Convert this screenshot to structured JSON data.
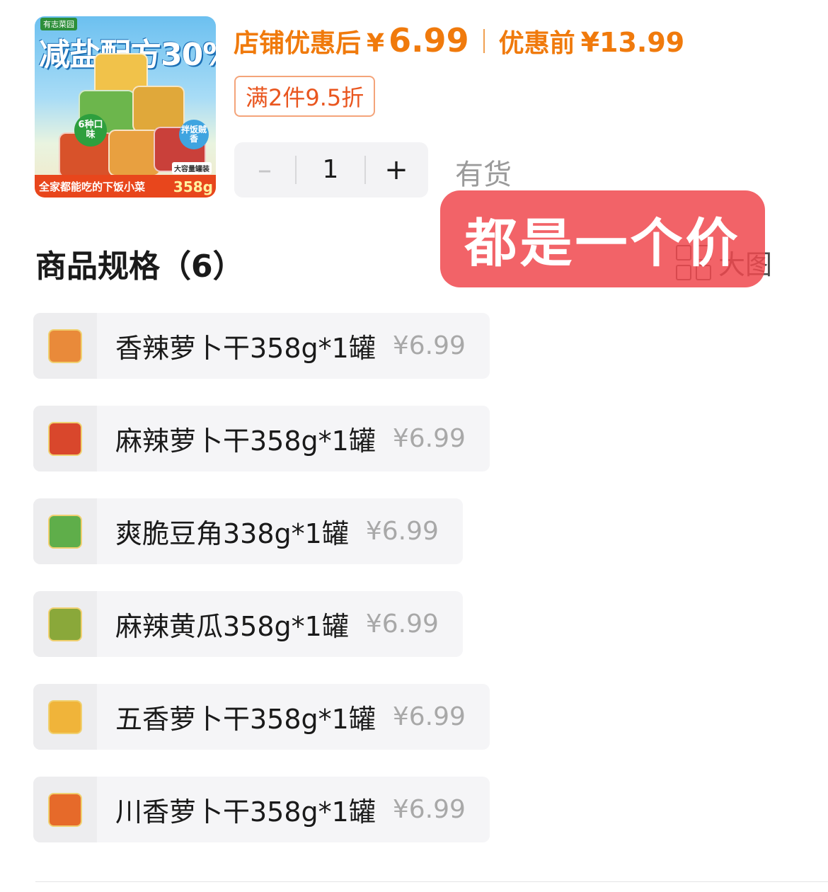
{
  "product_image": {
    "brand": "有志菜园",
    "headline": "减盐配方30%!",
    "badge_flavors": "6种口味",
    "badge_mix": "拌饭贼香",
    "capacity": "大容量罐装",
    "footer": "全家都能吃的下饭小菜",
    "weight": "358g"
  },
  "pricing": {
    "discount_label": "店铺优惠后",
    "currency": "¥",
    "discount_price": "6.99",
    "original_label": "优惠前",
    "original_price": "¥13.99"
  },
  "promotion": "满2件9.5折",
  "quantity": {
    "minus": "–",
    "value": "1",
    "plus": "+"
  },
  "stock_status": "有货",
  "specs": {
    "title": "商品规格（6）",
    "view_large": "大图",
    "items": [
      {
        "name": "香辣萝卜干358g*1罐",
        "price": "¥6.99"
      },
      {
        "name": "麻辣萝卜干358g*1罐",
        "price": "¥6.99"
      },
      {
        "name": "爽脆豆角338g*1罐",
        "price": "¥6.99"
      },
      {
        "name": "麻辣黄瓜358g*1罐",
        "price": "¥6.99"
      },
      {
        "name": "五香萝卜干358g*1罐",
        "price": "¥6.99"
      },
      {
        "name": "川香萝卜干358g*1罐",
        "price": "¥6.99"
      }
    ]
  },
  "overlay_note": "都是一个价",
  "colors": {
    "accent_orange": "#f07a0c",
    "promo_red": "#e9561f",
    "overlay_red": "#f0484e"
  }
}
